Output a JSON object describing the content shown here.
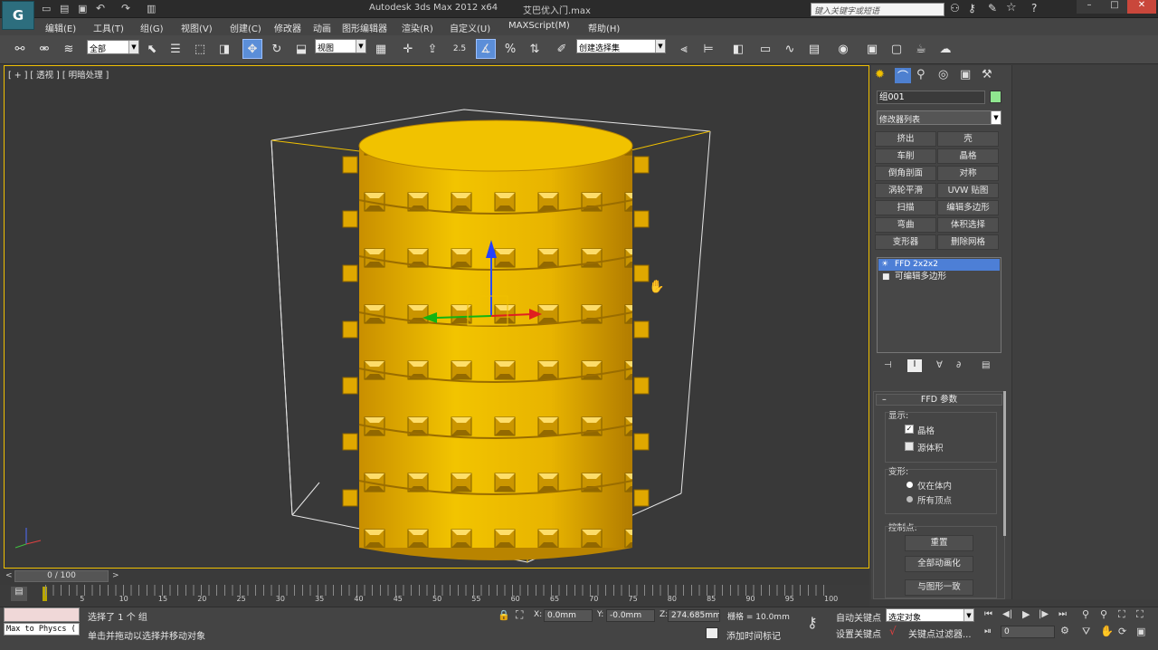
{
  "title_bar": {
    "app_title": "Autodesk 3ds Max  2012 x64",
    "file_name": "艾巴优入门.max",
    "search_placeholder": "键入关键字或短语"
  },
  "menu": [
    "编辑(E)",
    "工具(T)",
    "组(G)",
    "视图(V)",
    "创建(C)",
    "修改器",
    "动画",
    "图形编辑器",
    "渲染(R)",
    "自定义(U)",
    "MAXScript(M)",
    "帮助(H)"
  ],
  "toolbar": {
    "filter_value": "全部",
    "refcoord_value": "视图",
    "snap_value": "2.5",
    "selection_set_value": "创建选择集"
  },
  "viewport": {
    "label": "[ + ] [ 透视 ] [ 明暗处理 ]"
  },
  "command_panel": {
    "object_name": "组001",
    "object_color": "#8fe68f",
    "modifier_list": "修改器列表",
    "modifier_buttons": [
      [
        "挤出",
        "壳"
      ],
      [
        "车削",
        "晶格"
      ],
      [
        "倒角剖面",
        "对称"
      ],
      [
        "涡轮平滑",
        "UVW 贴图"
      ],
      [
        "扫描",
        "编辑多边形"
      ],
      [
        "弯曲",
        "体积选择"
      ],
      [
        "变形器",
        "删除网格"
      ]
    ],
    "stack": [
      "FFD 2x2x2",
      "可编辑多边形"
    ],
    "rollout_title": "FFD 参数",
    "display_label": "显示:",
    "lattice_label": "晶格",
    "lattice_checked": true,
    "source_volume_label": "源体积",
    "source_volume_checked": false,
    "deform_label": "变形:",
    "only_in_volume_label": "仅在体内",
    "all_vertices_label": "所有顶点",
    "control_points_label": "控制点:",
    "reset_button": "重置",
    "animate_all_button": "全部动画化",
    "conform_button": "与图形一致"
  },
  "timeline": {
    "position": "0 / 100",
    "current_frame": 0,
    "total_frames": 100,
    "ticks": [
      5,
      10,
      15,
      20,
      25,
      30,
      35,
      40,
      45,
      50,
      55,
      60,
      65,
      70,
      75,
      80,
      85,
      90,
      95,
      100
    ]
  },
  "status": {
    "maxscript": "Max to Physcs (",
    "selection_msg": "选择了 1 个 组",
    "prompt_msg": "单击并拖动以选择并移动对象",
    "x_label": "X:",
    "x_value": "0.0mm",
    "y_label": "Y:",
    "y_value": "-0.0mm",
    "z_label": "Z:",
    "z_value": "274.685mm",
    "grid": "栅格 = 10.0mm",
    "add_time_tag": "添加时间标记",
    "auto_key": "自动关键点",
    "auto_key_value": "选定对象",
    "set_key": "设置关键点",
    "key_filters": "关键点过滤器...",
    "frame_value": "0"
  },
  "colors": {
    "gold": "#e8b400",
    "selection": "#f0c000",
    "viewport_bg": "#393939"
  }
}
